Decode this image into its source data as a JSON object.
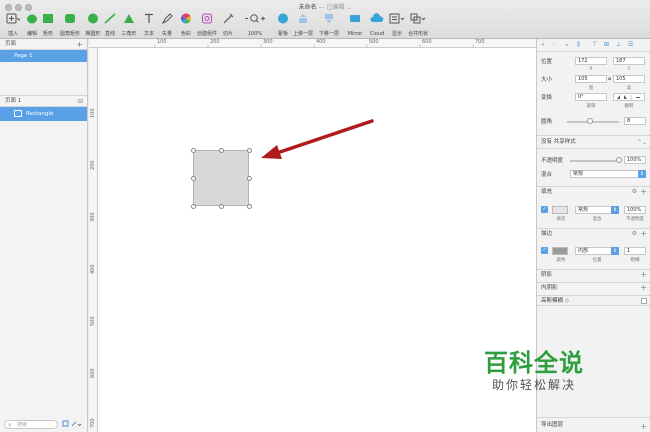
{
  "window": {
    "title": "未命名",
    "status": "— 已编辑 ⌄"
  },
  "toolbar": {
    "tools": [
      {
        "id": "insert",
        "label": "插入"
      },
      {
        "id": "edit",
        "label": "编辑"
      },
      {
        "id": "rect",
        "label": "矩形"
      },
      {
        "id": "rounded",
        "label": "圆角矩形"
      },
      {
        "id": "oval",
        "label": "椭圆形"
      },
      {
        "id": "line",
        "label": "直线"
      },
      {
        "id": "triangle",
        "label": "三角形"
      },
      {
        "id": "text",
        "label": "文本"
      },
      {
        "id": "vector",
        "label": "矢量"
      },
      {
        "id": "color",
        "label": "色彩"
      },
      {
        "id": "symbol",
        "label": "创建组件"
      },
      {
        "id": "slice",
        "label": "切片"
      },
      {
        "id": "zoom",
        "label": "100%"
      },
      {
        "id": "mask",
        "label": "蒙板"
      },
      {
        "id": "forward",
        "label": "上移一层"
      },
      {
        "id": "backward",
        "label": "下移一层"
      },
      {
        "id": "mirror",
        "label": "Mirror"
      },
      {
        "id": "cloud",
        "label": "Cloud"
      },
      {
        "id": "view",
        "label": "显示"
      },
      {
        "id": "combine",
        "label": "合并形状"
      }
    ]
  },
  "sidebar": {
    "pages_header": "页面",
    "page_item": "Page 1",
    "layers_header": "页面 1",
    "layer_item": "Rectangle",
    "search_placeholder": "搜索"
  },
  "rulers": {
    "top": [
      "100",
      "200",
      "300",
      "400",
      "500",
      "600",
      "700"
    ],
    "left": [
      "100",
      "200",
      "300",
      "400",
      "500",
      "600",
      "700"
    ]
  },
  "inspector": {
    "position_label": "位置",
    "x_value": "172",
    "y_value": "187",
    "x_sub": "X",
    "y_sub": "Y",
    "size_label": "大小",
    "w_value": "105",
    "h_value": "105",
    "w_sub": "宽",
    "h_sub": "高",
    "transform_label": "变换",
    "rotate_value": "0°",
    "rotate_sub": "旋转",
    "flip_sub": "翻转",
    "radius_label": "圆角",
    "radius_value": "8",
    "shared_style": "没有 共享样式",
    "opacity_label": "不透明度",
    "opacity_value": "100%",
    "blend_label": "混合",
    "blend_value": "常规",
    "fill_section": "填充",
    "fill_blend": "常规",
    "fill_opacity": "100%",
    "fill_sub_1": "填充",
    "fill_sub_2": "混合",
    "fill_sub_3": "不透明度",
    "border_section": "描边",
    "border_position": "内部",
    "border_width": "1",
    "border_sub_1": "颜色",
    "border_sub_2": "位置",
    "border_sub_3": "粗细",
    "shadow_section": "阴影",
    "inner_shadow_section": "内阴影",
    "blur_section": "高斯模糊 ◇",
    "export_section": "导出图层"
  },
  "watermark": {
    "title": "百科全说",
    "subtitle": "助你轻松解决"
  },
  "colors": {
    "accent": "#5aa0e6",
    "arrow": "#b01c1c",
    "watermark": "#2f9e3f"
  }
}
